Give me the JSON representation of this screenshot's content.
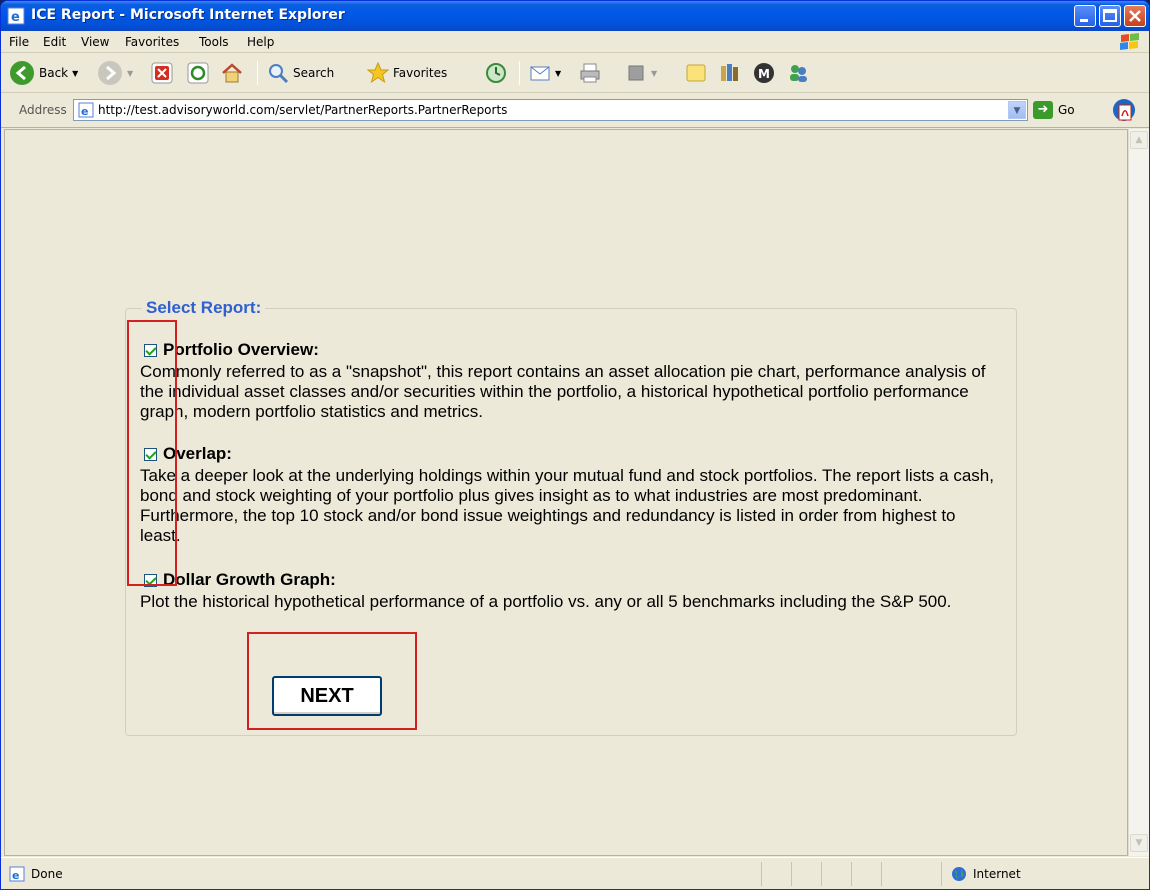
{
  "window": {
    "title": "ICE Report - Microsoft Internet Explorer"
  },
  "menu": {
    "items": [
      "File",
      "Edit",
      "View",
      "Favorites",
      "Tools",
      "Help"
    ]
  },
  "toolbar": {
    "back_label": "Back",
    "search_label": "Search",
    "favorites_label": "Favorites"
  },
  "address": {
    "label": "Address",
    "url": "http://test.advisoryworld.com/servlet/PartnerReports.PartnerReports",
    "go_label": "Go"
  },
  "report": {
    "legend": "Select Report:",
    "items": [
      {
        "title": "Portfolio Overview:",
        "checked": true,
        "description": "Commonly referred to as a \"snapshot\", this report contains an asset allocation pie chart, performance analysis of the individual asset classes and/or securities within the portfolio, a historical hypothetical portfolio performance graph, modern portfolio statistics and metrics."
      },
      {
        "title": "Overlap:",
        "checked": true,
        "description": "Take a deeper look at the underlying holdings within your mutual fund and stock portfolios. The report lists a cash, bond and stock weighting of your portfolio plus gives insight as to what industries are most predominant. Furthermore, the top 10 stock and/or bond issue weightings and redundancy is listed in order from highest to least."
      },
      {
        "title": "Dollar Growth Graph:",
        "checked": true,
        "description": "Plot the historical hypothetical performance of a portfolio vs. any or all 5 benchmarks including the S&P 500."
      }
    ],
    "next_label": "NEXT"
  },
  "status": {
    "text": "Done",
    "zone": "Internet"
  },
  "colors": {
    "legend": "#2f5fd0",
    "highlight": "#d42020",
    "titlebar": "#0058e6"
  }
}
